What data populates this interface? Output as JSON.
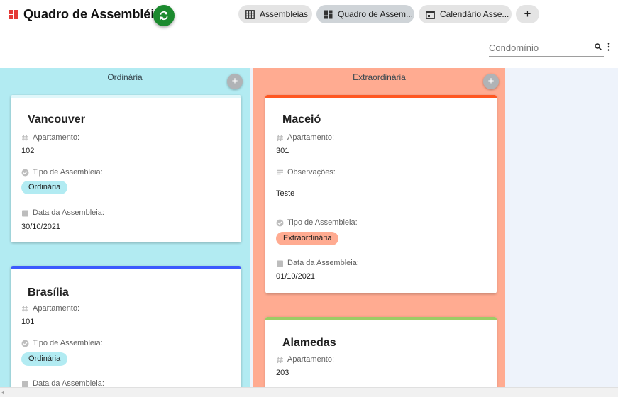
{
  "header": {
    "title": "Quadro de Assembléias",
    "logo_icon": "grid-logo-icon",
    "sync_icon": "sync-icon",
    "accent_color": "#1b8a2e"
  },
  "tabs": [
    {
      "label": "Assembleias",
      "icon": "grid-icon",
      "active": false
    },
    {
      "label": "Quadro de Assem...",
      "icon": "kanban-icon",
      "active": true
    },
    {
      "label": "Calendário Asse...",
      "icon": "calendar-icon",
      "active": false
    }
  ],
  "add_tab_label": "+",
  "search": {
    "placeholder": "Condomínio",
    "value": ""
  },
  "columns": [
    {
      "title": "Ordinária",
      "color": "#b2ebf2",
      "add_label": "+",
      "cards": [
        {
          "title": "Vancouver",
          "bar_color": "#e0f7fa",
          "apartment_label": "Apartamento:",
          "apartment": "102",
          "type_label": "Tipo de Assembleia:",
          "type": "Ordinária",
          "date_label": "Data da Assembleia:",
          "date": "30/10/2021"
        },
        {
          "title": "Brasília",
          "bar_color": "#3d5afe",
          "apartment_label": "Apartamento:",
          "apartment": "101",
          "type_label": "Tipo de Assembleia:",
          "type": "Ordinária",
          "date_label": "Data da Assembleia:"
        }
      ]
    },
    {
      "title": "Extraordinária",
      "color": "#ffab91",
      "add_label": "+",
      "cards": [
        {
          "title": "Maceió",
          "bar_color": "#ff5722",
          "apartment_label": "Apartamento:",
          "apartment": "301",
          "notes_label": "Observações:",
          "notes": "Teste",
          "type_label": "Tipo de Assembleia:",
          "type": "Extraordinária",
          "date_label": "Data da Assembleia:",
          "date": "01/10/2021"
        },
        {
          "title": "Alamedas",
          "bar_color": "#9ccc65",
          "apartment_label": "Apartamento:",
          "apartment": "203"
        }
      ]
    }
  ]
}
